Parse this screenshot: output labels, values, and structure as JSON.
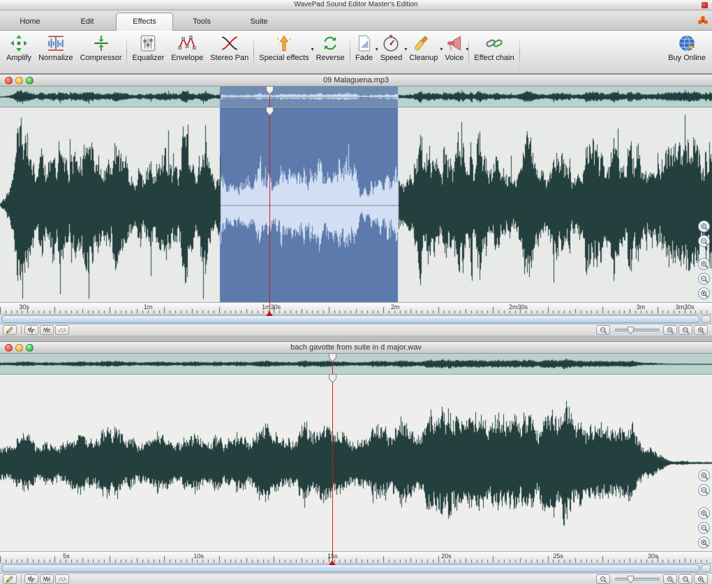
{
  "app_titlebar": {
    "title": "WavePad Sound Editor Master's Edition"
  },
  "tab_bar": {
    "tabs": [
      {
        "label": "Home",
        "active": false
      },
      {
        "label": "Edit",
        "active": false
      },
      {
        "label": "Effects",
        "active": true
      },
      {
        "label": "Tools",
        "active": false
      },
      {
        "label": "Suite",
        "active": false
      }
    ]
  },
  "toolbar": {
    "buttons": [
      {
        "label": "Amplify",
        "icon": "amplify-icon",
        "dropdown": false
      },
      {
        "label": "Normalize",
        "icon": "normalize-icon",
        "dropdown": false
      },
      {
        "label": "Compressor",
        "icon": "compressor-icon",
        "dropdown": false
      },
      {
        "label": "Equalizer",
        "icon": "equalizer-icon",
        "dropdown": false
      },
      {
        "label": "Envelope",
        "icon": "envelope-icon",
        "dropdown": false
      },
      {
        "label": "Stereo Pan",
        "icon": "stereo-pan-icon",
        "dropdown": false
      },
      {
        "label": "Special effects",
        "icon": "special-effects-icon",
        "dropdown": true
      },
      {
        "label": "Reverse",
        "icon": "reverse-icon",
        "dropdown": false
      },
      {
        "label": "Fade",
        "icon": "fade-icon",
        "dropdown": true
      },
      {
        "label": "Speed",
        "icon": "speed-icon",
        "dropdown": true
      },
      {
        "label": "Cleanup",
        "icon": "cleanup-icon",
        "dropdown": true
      },
      {
        "label": "Voice",
        "icon": "voice-icon",
        "dropdown": true
      },
      {
        "label": "Effect chain",
        "icon": "effect-chain-icon",
        "dropdown": false
      },
      {
        "label": "Buy Online",
        "icon": "buy-online-icon",
        "dropdown": false
      }
    ]
  },
  "windows": [
    {
      "title": "09 Malaguena.mp3",
      "cursor_pos": 0.378,
      "selection": {
        "start": 0.309,
        "end": 0.559
      },
      "timeline_labels": [
        {
          "text": "30s",
          "pos": 0.034
        },
        {
          "text": "1m",
          "pos": 0.208
        },
        {
          "text": "1m30s",
          "pos": 0.381
        },
        {
          "text": "2m",
          "pos": 0.555
        },
        {
          "text": "2m30s",
          "pos": 0.728
        },
        {
          "text": "3m",
          "pos": 0.9
        },
        {
          "text": "3m30s",
          "pos": 0.962
        }
      ],
      "wave": {
        "seed": 7,
        "style": "spiky",
        "profile": [
          [
            0,
            0.04
          ],
          [
            0.012,
            0.5
          ],
          [
            0.03,
            0.92
          ],
          [
            0.06,
            0.75
          ],
          [
            0.1,
            0.95
          ],
          [
            0.13,
            0.8
          ],
          [
            0.16,
            1.0
          ],
          [
            0.2,
            0.78
          ],
          [
            0.25,
            0.85
          ],
          [
            0.3,
            0.72
          ],
          [
            0.315,
            0.55
          ],
          [
            0.35,
            0.5
          ],
          [
            0.4,
            0.46
          ],
          [
            0.45,
            0.52
          ],
          [
            0.5,
            0.48
          ],
          [
            0.54,
            0.55
          ],
          [
            0.562,
            0.82
          ],
          [
            0.6,
            0.95
          ],
          [
            0.65,
            0.8
          ],
          [
            0.7,
            0.9
          ],
          [
            0.75,
            0.78
          ],
          [
            0.8,
            0.88
          ],
          [
            0.85,
            0.75
          ],
          [
            0.9,
            0.85
          ],
          [
            0.95,
            0.7
          ],
          [
            1,
            0.75
          ]
        ]
      },
      "colors": {
        "overview_bg": "#b9d2ce",
        "main_bg": "#e8eae7",
        "wave": "#24403e",
        "selection_bg": "#5d7aac",
        "selection_wave": "#d2def4",
        "cursor": "#d01818"
      }
    },
    {
      "title": "bach gavotte from suite in d major.wav",
      "cursor_pos": 0.467,
      "selection": null,
      "timeline_labels": [
        {
          "text": "5s",
          "pos": 0.093
        },
        {
          "text": "10s",
          "pos": 0.279
        },
        {
          "text": "15s",
          "pos": 0.467
        },
        {
          "text": "20s",
          "pos": 0.627
        },
        {
          "text": "25s",
          "pos": 0.784
        },
        {
          "text": "30s",
          "pos": 0.917
        }
      ],
      "wave": {
        "seed": 42,
        "style": "smooth",
        "profile": [
          [
            0,
            0.2
          ],
          [
            0.03,
            0.33
          ],
          [
            0.08,
            0.28
          ],
          [
            0.12,
            0.38
          ],
          [
            0.17,
            0.45
          ],
          [
            0.2,
            0.32
          ],
          [
            0.25,
            0.4
          ],
          [
            0.3,
            0.36
          ],
          [
            0.35,
            0.48
          ],
          [
            0.4,
            0.42
          ],
          [
            0.45,
            0.5
          ],
          [
            0.5,
            0.45
          ],
          [
            0.55,
            0.52
          ],
          [
            0.6,
            0.58
          ],
          [
            0.64,
            0.7
          ],
          [
            0.67,
            0.78
          ],
          [
            0.7,
            0.6
          ],
          [
            0.73,
            0.55
          ],
          [
            0.77,
            0.62
          ],
          [
            0.8,
            0.78
          ],
          [
            0.83,
            0.68
          ],
          [
            0.86,
            0.55
          ],
          [
            0.89,
            0.42
          ],
          [
            0.91,
            0.25
          ],
          [
            0.925,
            0.1
          ],
          [
            0.94,
            0.03
          ],
          [
            1,
            0.01
          ]
        ]
      },
      "colors": {
        "overview_bg": "#b9d2ce",
        "main_bg": "#eeefec",
        "wave": "#24403e",
        "selection_bg": "#5d7aac",
        "selection_wave": "#d2def4",
        "cursor": "#d01818"
      }
    }
  ],
  "window_controls": [
    {
      "name": "close-button",
      "color": "red"
    },
    {
      "name": "minimize-button",
      "color": "yellow"
    },
    {
      "name": "zoom-button",
      "color": "green"
    }
  ],
  "edit_tools": [
    {
      "icon": "pencil-icon",
      "name": "draw-tool-button"
    },
    {
      "icon": "wave-select-icon",
      "name": "select-tool-button"
    },
    {
      "icon": "wave-scrub-icon",
      "name": "scrub-tool-button"
    },
    {
      "icon": "sample-grid-icon",
      "name": "sample-view-button"
    }
  ],
  "zoom_rail": [
    {
      "icon": "zoom-in-icon",
      "name": "vertical-zoom-in-button",
      "group": 0
    },
    {
      "icon": "zoom-out-icon",
      "name": "vertical-zoom-out-button",
      "group": 0
    },
    {
      "icon": "zoom-in-icon",
      "name": "zoom-in-button",
      "group": 1
    },
    {
      "icon": "zoom-out-icon",
      "name": "zoom-out-button",
      "group": 1
    },
    {
      "icon": "zoom-full-icon",
      "name": "zoom-full-button",
      "group": 1
    }
  ],
  "zoom_slider": {
    "value": 0.3,
    "left_icon": "zoom-out-icon",
    "right_icon": "zoom-in-icon",
    "extra_buttons": [
      {
        "icon": "zoom-selection-icon",
        "name": "zoom-to-selection-button"
      },
      {
        "icon": "zoom-full-icon",
        "name": "zoom-all-button"
      }
    ]
  }
}
